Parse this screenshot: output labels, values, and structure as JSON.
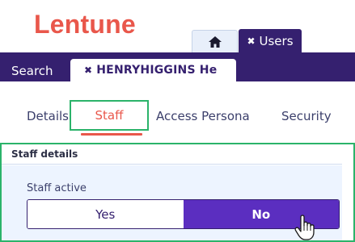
{
  "app": {
    "logo_text": "Lentune"
  },
  "top_tabs": {
    "home_icon": "home-icon",
    "users": {
      "close_glyph": "✖",
      "label": "Users"
    }
  },
  "nav": {
    "search_label": "Search",
    "record_tab": {
      "close_glyph": "✖",
      "label": "HENRYHIGGINS He"
    }
  },
  "subtabs": [
    {
      "label": "Details"
    },
    {
      "label": "Staff",
      "active": true
    },
    {
      "label": "Access Persona"
    },
    {
      "label": "Security"
    }
  ],
  "staff_panel": {
    "title": "Staff details",
    "fields": {
      "staff_active": {
        "label": "Staff active",
        "options": [
          "Yes",
          "No"
        ],
        "selected": "No"
      }
    }
  },
  "cursor": {
    "icon": "hand-pointer-icon"
  },
  "colors": {
    "brand_red": "#e9574b",
    "brand_purple": "#35206f",
    "selected_purple": "#5b2ec0",
    "highlight_green": "#2bb36a",
    "panel_bg": "#edf4ff"
  }
}
